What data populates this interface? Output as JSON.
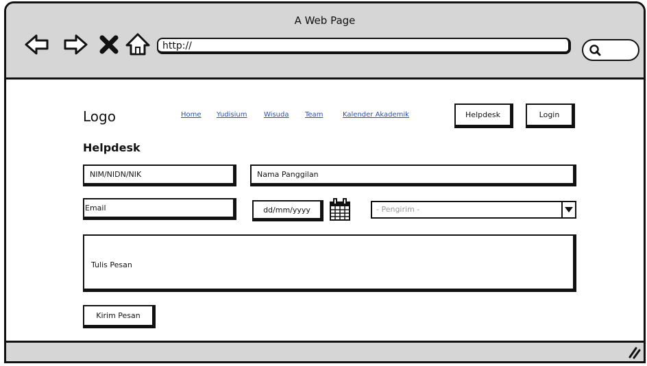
{
  "window": {
    "title": "A Web Page"
  },
  "browser": {
    "back_icon": "back-arrow-icon",
    "forward_icon": "forward-arrow-icon",
    "stop_icon": "close-icon",
    "home_icon": "home-icon",
    "url": "http://",
    "search_icon": "search-icon",
    "resize_icon": "resize-grip-icon"
  },
  "header": {
    "logo": "Logo",
    "nav": [
      "Home",
      "Yudisium",
      "Wisuda",
      "Team",
      "Kalender Akademik"
    ],
    "buttons": {
      "helpdesk": "Helpdesk",
      "login": "Login"
    }
  },
  "form": {
    "heading": "Helpdesk",
    "nim_field": "NIM/NIDN/NIK",
    "nickname_field": "Nama Panggilan",
    "email_field": "Email",
    "date_field": "dd/mm/yyyy",
    "calendar_icon": "calendar-icon",
    "sender_select": "- Pengirim -",
    "message_field": "Tulis Pesan",
    "submit_label": "Kirim Pesan"
  },
  "colors": {
    "chrome": "#d6d6d6",
    "link": "#2b4fb0",
    "placeholder": "#9a9a9a",
    "stroke": "#111111"
  }
}
